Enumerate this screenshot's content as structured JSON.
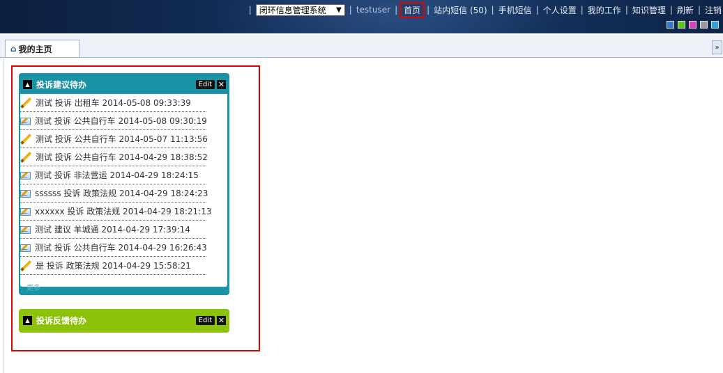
{
  "header": {
    "system_select": "闭环信息管理系统",
    "nav": [
      {
        "label": "testuser"
      },
      {
        "label": "首页"
      },
      {
        "label": "站内短信 (50)"
      },
      {
        "label": "手机短信"
      },
      {
        "label": "个人设置"
      },
      {
        "label": "我的工作"
      },
      {
        "label": "知识管理"
      },
      {
        "label": "刷新"
      },
      {
        "label": "注销"
      }
    ],
    "theme_swatches": [
      "#3b78c8",
      "#5ec21c",
      "#d83fc6",
      "#9a9a9a",
      "#27a4e0"
    ]
  },
  "tabs": [
    {
      "label": "我的主页",
      "icon": "home-icon"
    }
  ],
  "portlets": [
    {
      "title": "投诉建议待办",
      "edit_label": "Edit",
      "color": "#1b93a6",
      "items": [
        {
          "icon": "pencil-icon",
          "text": "测试 投诉 出租车 2014-05-08 09:33:39"
        },
        {
          "icon": "mail-edit-icon",
          "text": "测试 投诉 公共自行车 2014-05-08 09:30:19"
        },
        {
          "icon": "pencil-icon",
          "text": "测试 投诉 公共自行车 2014-05-07 11:13:56"
        },
        {
          "icon": "pencil-icon",
          "text": "测试 投诉 公共自行车 2014-04-29 18:38:52"
        },
        {
          "icon": "mail-edit-icon",
          "text": "测试 投诉 非法营运 2014-04-29 18:24:15"
        },
        {
          "icon": "mail-edit-icon",
          "text": "ssssss 投诉 政策法规 2014-04-29 18:24:23"
        },
        {
          "icon": "mail-edit-icon",
          "text": "xxxxxx 投诉 政策法规 2014-04-29 18:21:13"
        },
        {
          "icon": "mail-edit-icon",
          "text": "测试 建议 羊城通 2014-04-29 17:39:14"
        },
        {
          "icon": "mail-edit-icon",
          "text": "测试 投诉 公共自行车 2014-04-29 16:26:43"
        },
        {
          "icon": "pencil-icon",
          "text": "是 投诉 政策法规 2014-04-29 15:58:21"
        }
      ],
      "more_label": "更多"
    },
    {
      "title": "投诉反馈待办",
      "edit_label": "Edit",
      "color": "#8cc20a",
      "items": []
    }
  ]
}
